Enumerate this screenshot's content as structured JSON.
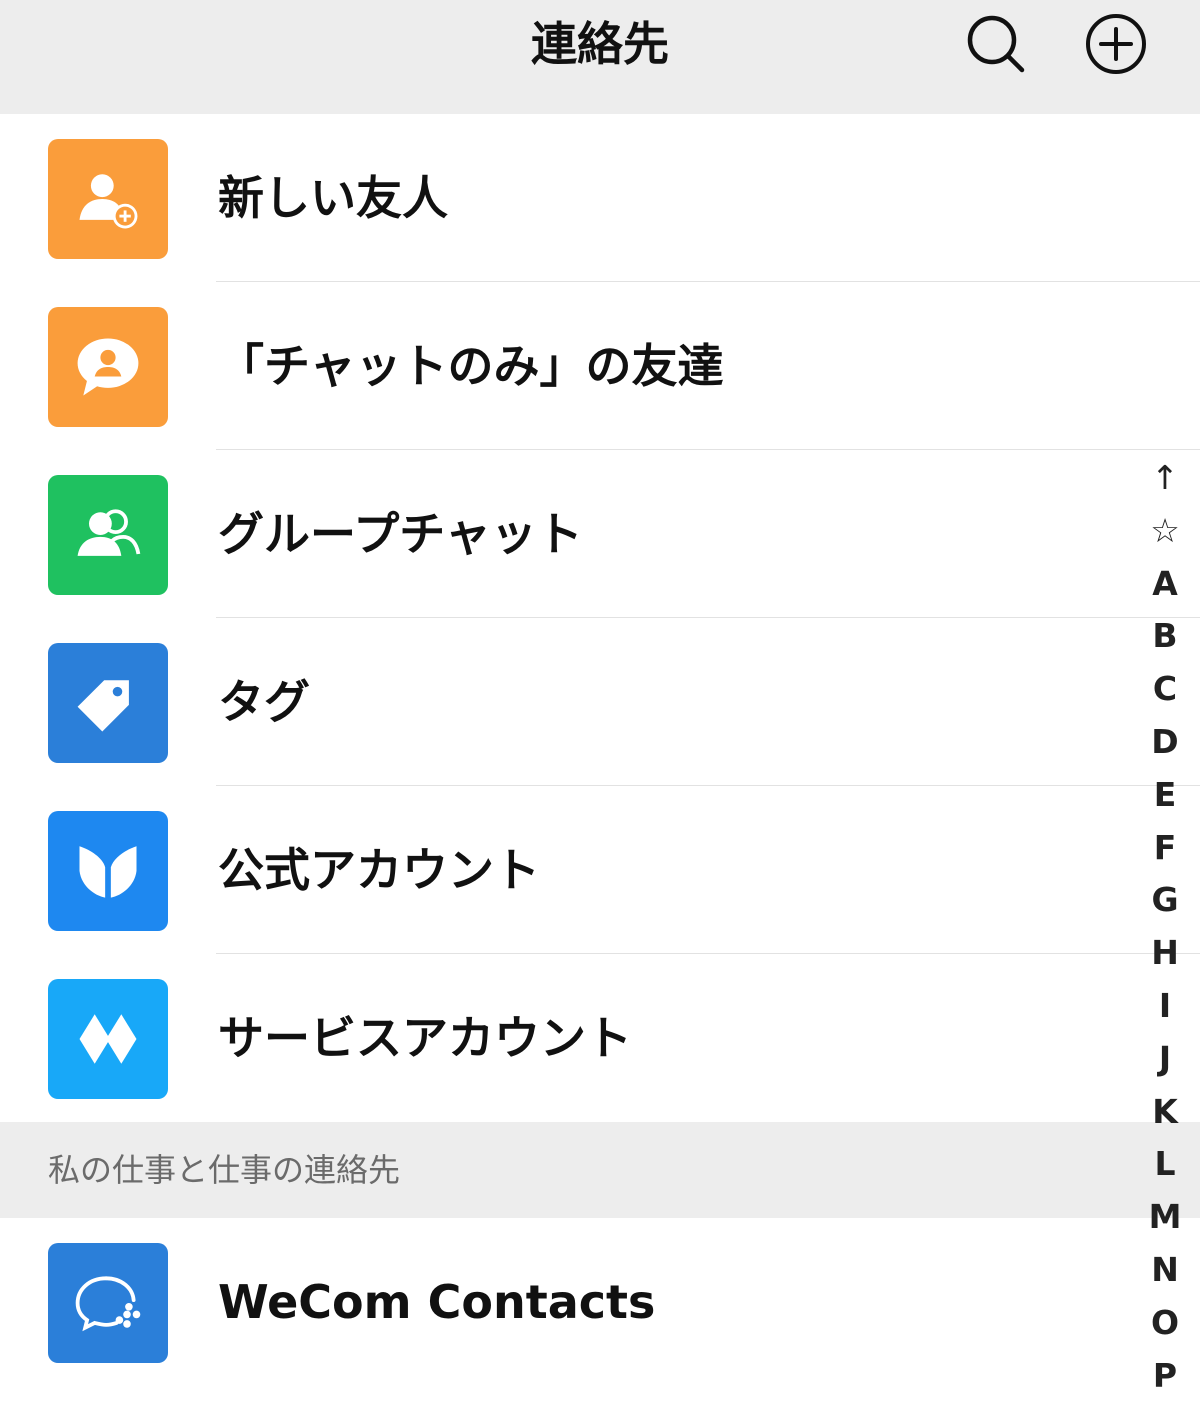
{
  "header": {
    "title": "連絡先",
    "search_icon": "search-icon",
    "add_icon": "add-circle-icon"
  },
  "menu": [
    {
      "label": "新しい友人",
      "icon": "add-friend-icon",
      "color": "#fa9d3b"
    },
    {
      "label": "「チャットのみ」の友達",
      "icon": "chat-person-icon",
      "color": "#fa9d3b"
    },
    {
      "label": "グループチャット",
      "icon": "group-icon",
      "color": "#1fc160"
    },
    {
      "label": "タグ",
      "icon": "tag-icon",
      "color": "#2b7fd9"
    },
    {
      "label": "公式アカウント",
      "icon": "official-account-icon",
      "color": "#1e88f0"
    },
    {
      "label": "サービスアカウント",
      "icon": "service-account-icon",
      "color": "#18a8f8"
    }
  ],
  "section": {
    "label": "私の仕事と仕事の連絡先"
  },
  "work": [
    {
      "label": "WeCom Contacts",
      "icon": "wecom-icon",
      "color": "#2b7fd9"
    }
  ],
  "index": [
    "↑",
    "☆",
    "A",
    "B",
    "C",
    "D",
    "E",
    "F",
    "G",
    "H",
    "I",
    "J",
    "K",
    "L",
    "M",
    "N",
    "O",
    "P"
  ]
}
